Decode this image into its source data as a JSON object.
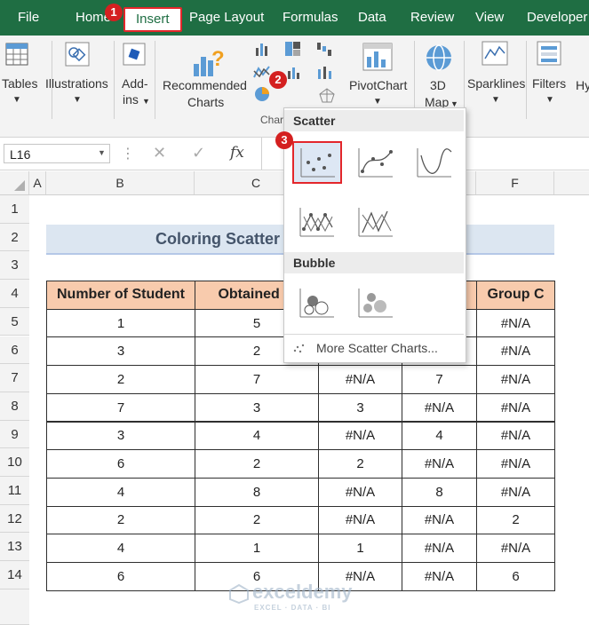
{
  "ribbon": {
    "tabs": [
      "File",
      "Home",
      "Insert",
      "Page Layout",
      "Formulas",
      "Data",
      "Review",
      "View",
      "Developer"
    ],
    "active_tab": "Insert",
    "buttons": {
      "tables": "Tables",
      "illustrations": "Illustrations",
      "addins_1": "Add-",
      "addins_2": "ins",
      "recommended_1": "Recommended",
      "recommended_2": "Charts",
      "pivotchart": "PivotChart",
      "map3d_1": "3D",
      "map3d_2": "Map",
      "sparklines": "Sparklines",
      "filters": "Filters",
      "hy": "Hy"
    },
    "group_charts": "Char"
  },
  "badges": [
    "1",
    "2",
    "3"
  ],
  "formula_bar": {
    "namebox": "L16",
    "fx": "fx"
  },
  "columns": [
    "A",
    "B",
    "C",
    "D",
    "E",
    "F"
  ],
  "rows": [
    "1",
    "2",
    "3",
    "4",
    "5",
    "6",
    "7",
    "8",
    "9",
    "10",
    "11",
    "12",
    "13",
    "14"
  ],
  "sheet": {
    "title": "Coloring Scatter",
    "headers": [
      "Number of Student",
      "Obtained M",
      "",
      "B",
      "Group C"
    ],
    "data": [
      [
        "1",
        "5",
        "",
        "",
        "#N/A"
      ],
      [
        "3",
        "2",
        "",
        "",
        "#N/A"
      ],
      [
        "2",
        "7",
        "#N/A",
        "7",
        "#N/A"
      ],
      [
        "7",
        "3",
        "3",
        "#N/A",
        "#N/A"
      ],
      [
        "3",
        "4",
        "#N/A",
        "4",
        "#N/A"
      ],
      [
        "6",
        "2",
        "2",
        "#N/A",
        "#N/A"
      ],
      [
        "4",
        "8",
        "#N/A",
        "8",
        "#N/A"
      ],
      [
        "2",
        "2",
        "#N/A",
        "#N/A",
        "2"
      ],
      [
        "4",
        "1",
        "1",
        "#N/A",
        "#N/A"
      ],
      [
        "6",
        "6",
        "#N/A",
        "#N/A",
        "6"
      ]
    ]
  },
  "dropdown": {
    "scatter_header": "Scatter",
    "bubble_header": "Bubble",
    "more": "More Scatter Charts..."
  },
  "watermark": {
    "name": "exceldemy",
    "tag": "EXCEL · DATA · BI"
  },
  "colors": {
    "ribbon_tab_bg": "#1f6e43",
    "highlight_red": "#e3262b",
    "header_fill": "#f8cbad",
    "title_fill": "#dce6f1"
  }
}
